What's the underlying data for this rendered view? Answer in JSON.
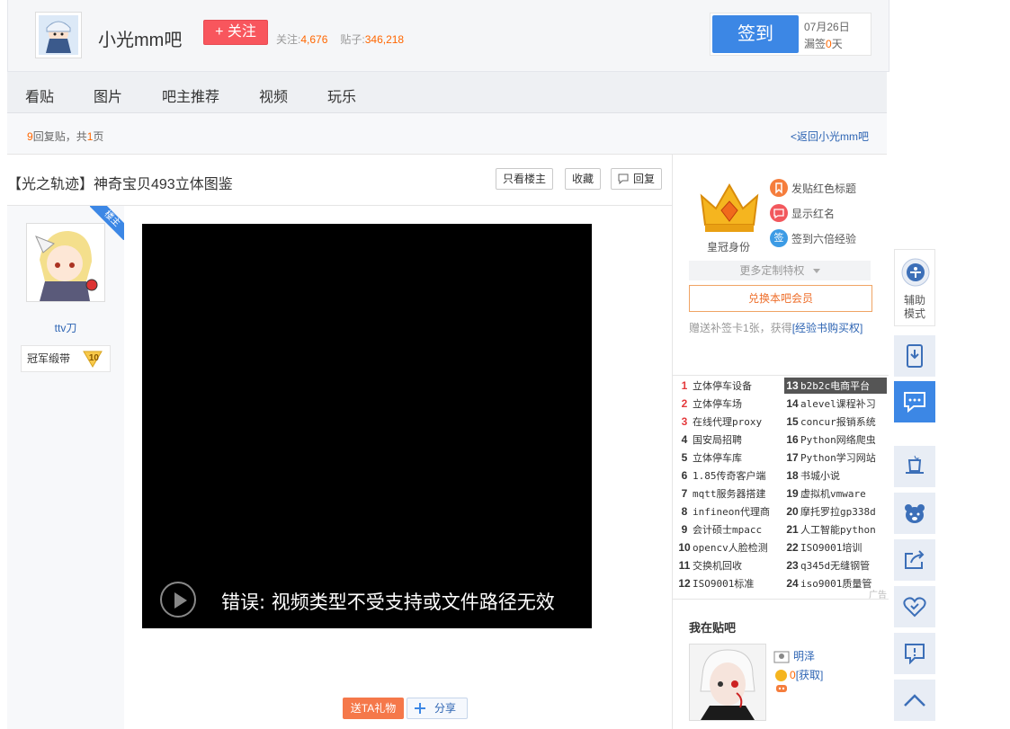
{
  "header": {
    "bar_name": "小光mm吧",
    "follow_label": "+ 关注",
    "followers_label": "关注:",
    "followers_count": "4,676",
    "posts_label": "贴子:",
    "posts_count": "346,218",
    "signin_label": "签到",
    "signin_date": "07月26日",
    "signin_missed_prefix": "漏签",
    "signin_missed_days": "0",
    "signin_missed_suffix": "天"
  },
  "nav": {
    "tabs": [
      {
        "label": "看贴"
      },
      {
        "label": "图片"
      },
      {
        "label": "吧主推荐"
      },
      {
        "label": "视频"
      },
      {
        "label": "玩乐"
      }
    ]
  },
  "reply_bar": {
    "reply_count": "9",
    "reply_text": "回复贴，共",
    "page_count": "1",
    "page_suffix": "页",
    "back_link": "<返回小光mm吧"
  },
  "post": {
    "title": "【光之轨迹】神奇宝贝493立体图鉴",
    "only_op_label": "只看楼主",
    "collect_label": "收藏",
    "reply_label": "回复",
    "op_tag": "楼主",
    "author_name": "ttv刀",
    "badge_label": "冠军缎带",
    "level": "10",
    "video_error": "错误: 视频类型不受支持或文件路径无效",
    "gift_label": "送TA礼物",
    "share_label": "分享"
  },
  "member": {
    "crown_label": "皇冠身份",
    "privileges": [
      {
        "label": "发贴红色标题",
        "icon": "bookmark-icon",
        "color": "#f57d3c"
      },
      {
        "label": "显示红名",
        "icon": "chat-icon",
        "color": "#f2585d"
      },
      {
        "label": "签到六倍经验",
        "icon": "sign-icon",
        "color": "#3c9be5",
        "glyph": "签"
      }
    ],
    "more_label": "更多定制特权",
    "member_btn": "兑换本吧会员",
    "note_prefix": "赠送补签卡1张，获得",
    "note_link": "[经验书购买权]"
  },
  "hot_list": {
    "items": [
      {
        "n": "1",
        "label": "立体停车设备"
      },
      {
        "n": "2",
        "label": "立体停车场"
      },
      {
        "n": "3",
        "label": "在线代理proxy"
      },
      {
        "n": "4",
        "label": "国安局招聘"
      },
      {
        "n": "5",
        "label": "立体停车库"
      },
      {
        "n": "6",
        "label": "1.85传奇客户端"
      },
      {
        "n": "7",
        "label": "mqtt服务器搭建"
      },
      {
        "n": "8",
        "label": "infineon代理商"
      },
      {
        "n": "9",
        "label": "会计硕士mpacc"
      },
      {
        "n": "10",
        "label": "opencv人脸检测"
      },
      {
        "n": "11",
        "label": "交换机回收"
      },
      {
        "n": "12",
        "label": "ISO9001标准"
      },
      {
        "n": "13",
        "label": "b2b2c电商平台"
      },
      {
        "n": "14",
        "label": "alevel课程补习"
      },
      {
        "n": "15",
        "label": "concur报销系统"
      },
      {
        "n": "16",
        "label": "Python网络爬虫"
      },
      {
        "n": "17",
        "label": "Python学习网站"
      },
      {
        "n": "18",
        "label": "书城小说"
      },
      {
        "n": "19",
        "label": "虚拟机vmware"
      },
      {
        "n": "20",
        "label": "摩托罗拉gp338d"
      },
      {
        "n": "21",
        "label": "人工智能python"
      },
      {
        "n": "22",
        "label": "ISO9001培训"
      },
      {
        "n": "23",
        "label": "q345d无缝钢管"
      },
      {
        "n": "24",
        "label": "iso9001质量管"
      }
    ],
    "ad_label": "广告"
  },
  "me": {
    "title": "我在贴吧",
    "name": "明泽",
    "coin_count": "0",
    "coin_link": "[获取]"
  },
  "sidebar": {
    "assist_label_1": "辅助",
    "assist_label_2": "模式"
  },
  "colors": {
    "accent": "#3c87e5",
    "follow": "#f8565d",
    "highlight": "#f66"
  }
}
